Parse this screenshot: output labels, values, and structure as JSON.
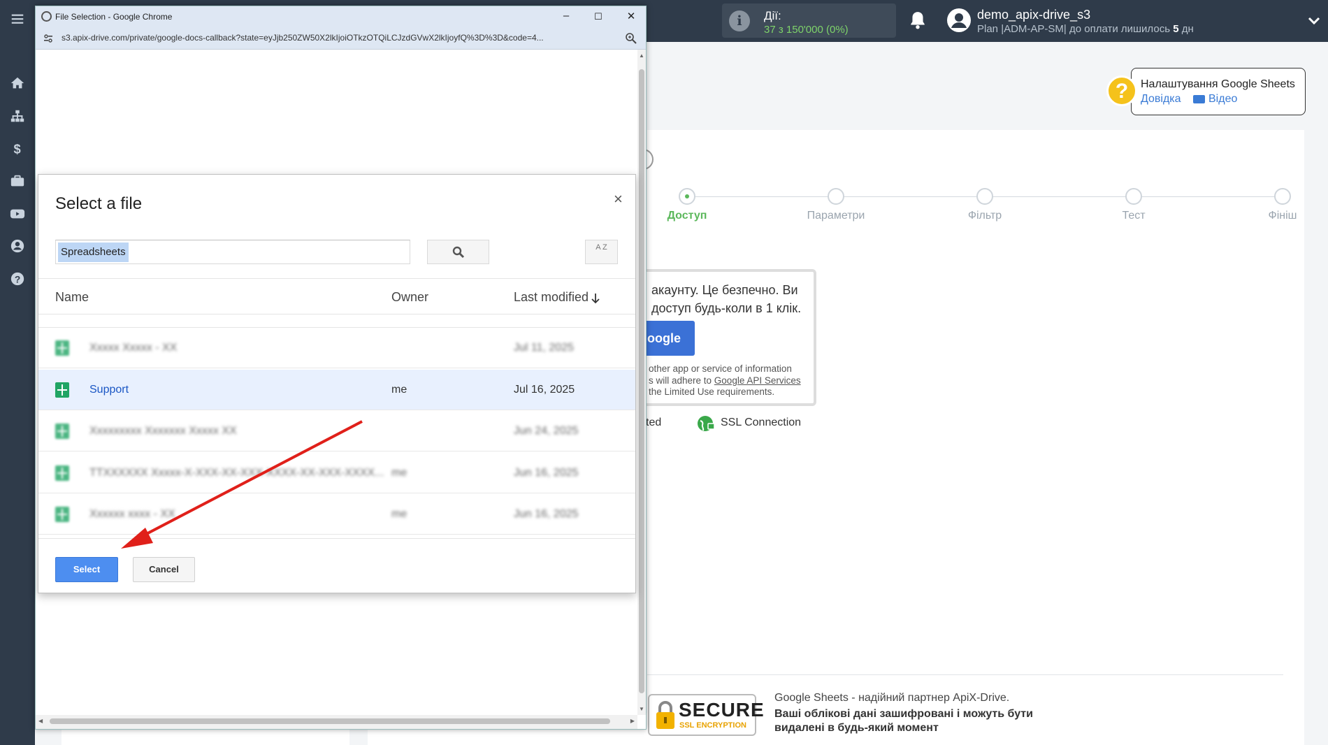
{
  "topbar": {
    "actions_label": "Дії:",
    "actions_value": "37 з 150'000 (0%)",
    "username": "demo_apix-drive_s3",
    "plan_prefix": "Plan |ADM-AP-SM| до оплати лишилось ",
    "plan_days": "5",
    "plan_suffix": " дн"
  },
  "sidebar": {
    "items": [
      "menu-icon",
      "home-icon",
      "sitemap-icon",
      "dollar-icon",
      "briefcase-icon",
      "video-icon",
      "user-icon",
      "help-icon"
    ]
  },
  "help": {
    "title": "Налаштування Google Sheets",
    "link_help": "Довідка",
    "link_video": "Відео"
  },
  "steps": {
    "items": [
      {
        "label": "Доступ",
        "active": true
      },
      {
        "label": "Параметри",
        "active": false
      },
      {
        "label": "Фільтр",
        "active": false
      },
      {
        "label": "Тест",
        "active": false
      },
      {
        "label": "Фініш",
        "active": false
      }
    ]
  },
  "access_box": {
    "text": "акаунту. Це безпечно. Ви доступ будь-коли в 1 клік.",
    "button": "oogle",
    "policy_1": "other app or service of information",
    "policy_2": "s will adhere to ",
    "policy_link": "Google API Services",
    "policy_3": "the Limited Use requirements."
  },
  "ssl": {
    "fragment": "ted",
    "label": "SSL Connection"
  },
  "secure_badge": {
    "title": "SECURE",
    "subtitle": "SSL ENCRYPTION"
  },
  "partner": {
    "line1": "Google Sheets - надійний партнер ApiX-Drive.",
    "line2": "Ваші облікові дані зашифровані і можуть бути видалені в будь-який момент"
  },
  "popup": {
    "window_title": "File Selection - Google Chrome",
    "url": "s3.apix-drive.com/private/google-docs-callback?state=eyJjb250ZW50X2lkIjoiOTkzOTQiLCJzdGVwX2lkIjoyfQ%3D%3D&code=4..."
  },
  "picker": {
    "title": "Select a file",
    "search_value": "Spreadsheets",
    "sort_label": "A Z",
    "columns": {
      "name": "Name",
      "owner": "Owner",
      "modified": "Last modified"
    },
    "rows": [
      {
        "name": "Ххххх Ххххх - ХХ",
        "owner": "",
        "date": "Jul 11, 2025",
        "blurred": true,
        "selected": false
      },
      {
        "name": "Support",
        "owner": "me",
        "date": "Jul 16, 2025",
        "blurred": false,
        "selected": true
      },
      {
        "name": "Ххххххххх Ххххххх Ххххх ХХ",
        "owner": "",
        "date": "Jun 24, 2025",
        "blurred": true,
        "selected": false
      },
      {
        "name": "ТТХХХХХХ Ххххх-Х-ХХХ-ХХ-ХХХ-ХХХХ-ХХ-ХХХ-ХХХХ...",
        "owner": "me",
        "date": "Jun 16, 2025",
        "blurred": true,
        "selected": false
      },
      {
        "name": "Хххххх хххх - ХХ",
        "owner": "me",
        "date": "Jun 16, 2025",
        "blurred": true,
        "selected": false
      }
    ],
    "select_button": "Select",
    "cancel_button": "Cancel"
  },
  "colors": {
    "sidebar": "#2f3b4a",
    "accent_green": "#5cb85c",
    "select_blue": "#4d8ef0",
    "arrow": "#e0201a"
  }
}
